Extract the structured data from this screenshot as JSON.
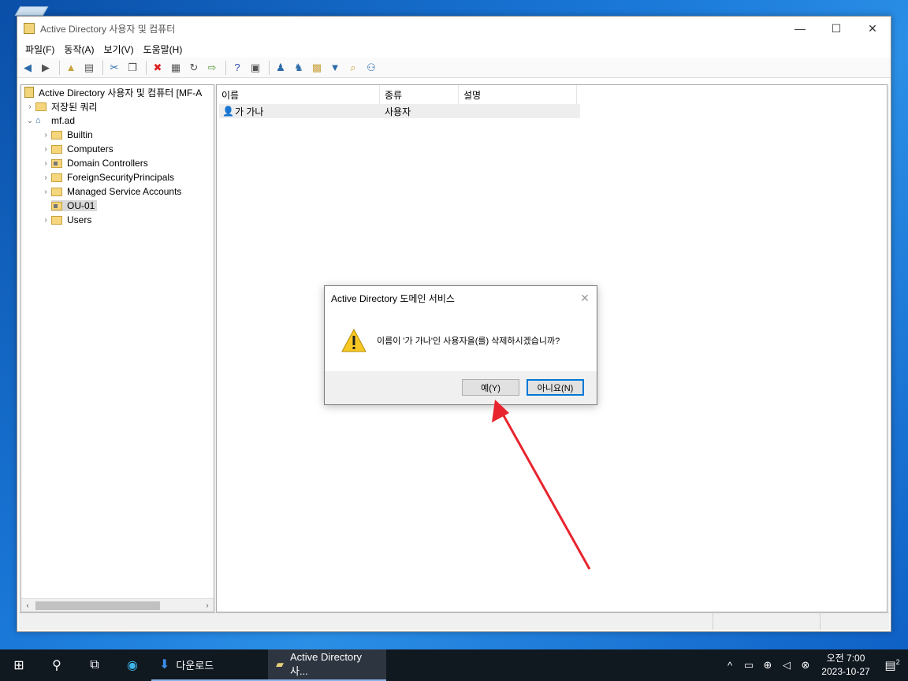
{
  "window": {
    "title": "Active Directory 사용자 및 컴퓨터",
    "min": "—",
    "max": "☐",
    "close": "✕"
  },
  "menu": [
    "파일(F)",
    "동작(A)",
    "보기(V)",
    "도움말(H)"
  ],
  "tree": {
    "root": "Active Directory 사용자 및 컴퓨터 [MF-A",
    "saved_queries": "저장된 쿼리",
    "domain": "mf.ad",
    "children": [
      "Builtin",
      "Computers",
      "Domain Controllers",
      "ForeignSecurityPrincipals",
      "Managed Service Accounts",
      "OU-01",
      "Users"
    ]
  },
  "list": {
    "columns": [
      "이름",
      "종류",
      "설명"
    ],
    "rows": [
      {
        "name": "가 가나",
        "type": "사용자",
        "desc": ""
      }
    ]
  },
  "dialog": {
    "title": "Active Directory 도메인 서비스",
    "message": "이름이 '가 가나'인 사용자을(를) 삭제하시겠습니까?",
    "yes": "예(Y)",
    "no": "아니요(N)",
    "close": "✕"
  },
  "taskbar": {
    "download_label": "다운로드",
    "active_app_label": "Active Directory 사...",
    "time": "오전 7:00",
    "date": "2023-10-27",
    "notification_count": "2"
  },
  "colors": {
    "accent": "#0078d7",
    "arrow": "#e8242e",
    "taskbar": "#101820"
  }
}
